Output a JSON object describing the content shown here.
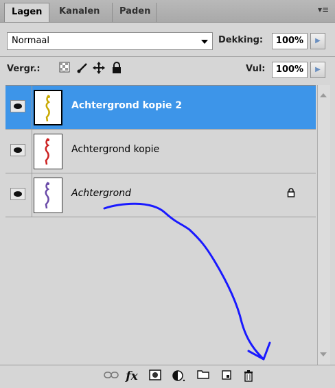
{
  "tabs": [
    {
      "label": "Lagen",
      "active": true
    },
    {
      "label": "Kanalen",
      "active": false
    },
    {
      "label": "Paden",
      "active": false
    }
  ],
  "panel_menu_icon": "panel-menu-icon",
  "blend": {
    "mode": "Normaal"
  },
  "opacity": {
    "label": "Dekking:",
    "value": "100%"
  },
  "lock": {
    "label": "Vergr.:",
    "icons": [
      "lock-transparent-icon",
      "lock-paint-icon",
      "lock-move-icon",
      "lock-all-icon"
    ]
  },
  "fill": {
    "label": "Vul:",
    "value": "100%"
  },
  "layers": [
    {
      "name": "Achtergrond kopie 2",
      "selected": true,
      "visible": true,
      "italic": false,
      "locked": false,
      "thumb_color": "#c8a800"
    },
    {
      "name": "Achtergrond kopie",
      "selected": false,
      "visible": true,
      "italic": false,
      "locked": false,
      "thumb_color": "#cc2222"
    },
    {
      "name": "Achtergrond",
      "selected": false,
      "visible": true,
      "italic": true,
      "locked": true,
      "thumb_color": "#6a4aa8"
    }
  ],
  "toolbar_icons": [
    "link-layers-icon",
    "fx-icon",
    "layer-mask-icon",
    "adjustment-layer-icon",
    "new-group-icon",
    "new-layer-icon",
    "trash-icon"
  ],
  "fx_label": "fx",
  "colors": {
    "selection": "#3d95e9",
    "annotation": "#1a1aff"
  }
}
